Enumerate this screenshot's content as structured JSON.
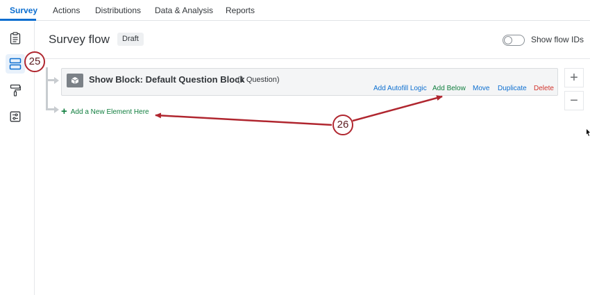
{
  "nav": {
    "tabs": [
      {
        "label": "Survey",
        "active": true
      },
      {
        "label": "Actions",
        "active": false
      },
      {
        "label": "Distributions",
        "active": false
      },
      {
        "label": "Data & Analysis",
        "active": false
      },
      {
        "label": "Reports",
        "active": false
      }
    ]
  },
  "rail": {
    "items": [
      {
        "icon": "clipboard-icon",
        "active": false
      },
      {
        "icon": "flow-icon",
        "active": true
      },
      {
        "icon": "paint-roller-icon",
        "active": false
      },
      {
        "icon": "options-sliders-icon",
        "active": false
      }
    ]
  },
  "header": {
    "title": "Survey flow",
    "badge": "Draft",
    "toggle_label": "Show flow IDs",
    "toggle_on": false
  },
  "block": {
    "title": "Show Block: Default Question Block",
    "count": "(1 Question)",
    "icon": "cube-icon",
    "actions": {
      "autofill": "Add Autofill Logic",
      "add_below": "Add Below",
      "move": "Move",
      "duplicate": "Duplicate",
      "delete": "Delete"
    }
  },
  "add_element": {
    "plus": "+",
    "label": "Add a New Element Here"
  },
  "zoom": {
    "in": "+",
    "out": "−"
  },
  "annotations": {
    "step_25": "25",
    "step_26": "26"
  },
  "colors": {
    "accent": "#0b6ed0",
    "green": "#107e3e",
    "delete_red": "#d1322b",
    "annotation": "#b0262f"
  }
}
